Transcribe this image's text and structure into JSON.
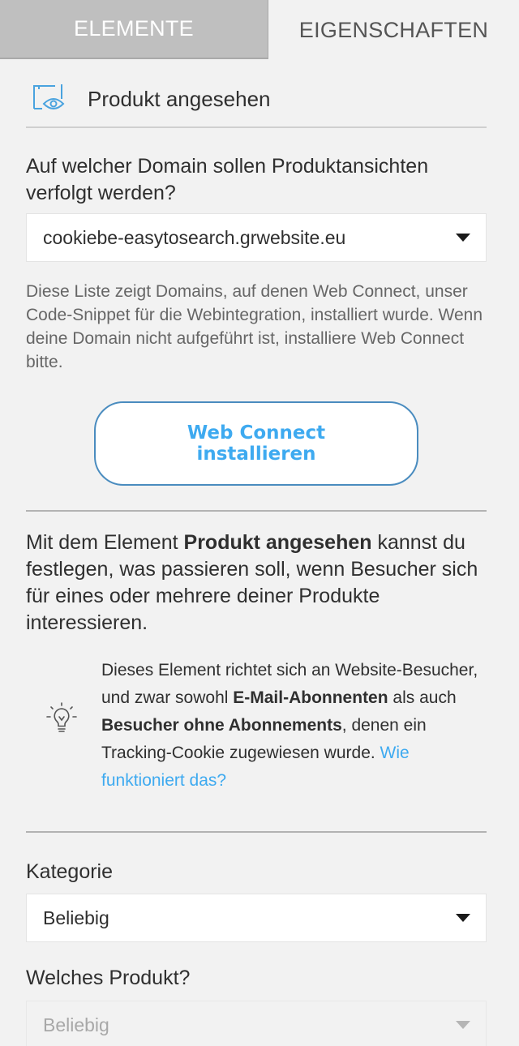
{
  "tabs": {
    "elemente": "ELEMENTE",
    "eigenschaften": "EIGENSCHAFTEN"
  },
  "header": {
    "title": "Produkt angesehen",
    "icon": "product-viewed-icon"
  },
  "domain": {
    "question": "Auf welcher Domain sollen Produktansichten verfolgt werden?",
    "selected": "cookiebe-easytosearch.grwebsite.eu",
    "help": "Diese Liste zeigt Domains, auf denen Web Connect, unser Code-Snippet für die Webintegration, installiert wurde. Wenn deine Domain nicht aufgeführt ist, installiere Web Connect bitte."
  },
  "cta": {
    "line1": "Web Connect",
    "line2": "installieren"
  },
  "description": {
    "before": "Mit dem Element ",
    "bold": "Produkt angesehen",
    "after": " kannst du festlegen, was passieren soll, wenn Besucher sich für eines oder mehrere deiner Produkte interessieren."
  },
  "tip": {
    "icon": "lightbulb-icon",
    "part1": "Dieses Element richtet sich an Website-Besucher, und zwar sowohl ",
    "bold1": "E-Mail-Abonnenten",
    "part2": " als auch ",
    "bold2": "Besucher ohne Abonnements",
    "part3": ", denen ein Tracking-Cookie zugewiesen wurde. ",
    "link": "Wie funktioniert das?"
  },
  "kategorie": {
    "label": "Kategorie",
    "selected": "Beliebig"
  },
  "produkt": {
    "label": "Welches Produkt?",
    "selected": "Beliebig"
  },
  "colors": {
    "accent": "#3eaaf0",
    "tab_inactive_bg": "#bfbfbf",
    "background": "#f2f2f2"
  }
}
